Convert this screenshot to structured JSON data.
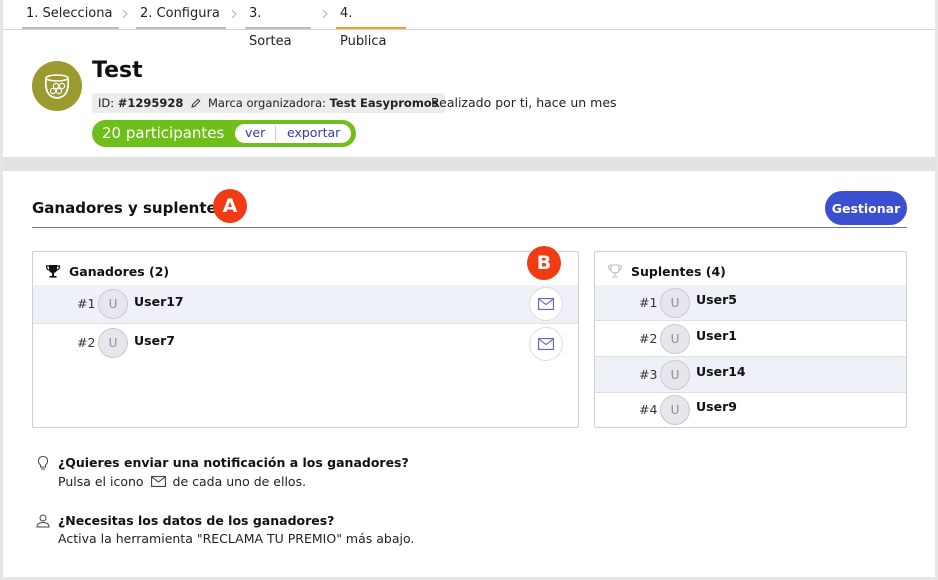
{
  "steps": [
    "1. Selecciona",
    "2. Configura",
    "3. Sortea",
    "4. Publica"
  ],
  "draw": {
    "title": "Test",
    "id_label": "ID:",
    "id_value": "#1295928",
    "brand_label": "Marca organizadora:",
    "brand_value": "Test Easypromos",
    "made_by": "Realizado por ti, hace un mes",
    "participants": "20 participantes",
    "view_link": "ver",
    "export_link": "exportar"
  },
  "section": {
    "title": "Ganadores y suplentes",
    "badge_a": "A",
    "badge_b": "B",
    "manage_button": "Gestionar"
  },
  "winners": {
    "header": "Ganadores (2)",
    "rows": [
      {
        "rank": "#1",
        "initial": "U",
        "name": "User17"
      },
      {
        "rank": "#2",
        "initial": "U",
        "name": "User7"
      }
    ]
  },
  "substitutes": {
    "header": "Suplentes (4)",
    "rows": [
      {
        "rank": "#1",
        "initial": "U",
        "name": "User5"
      },
      {
        "rank": "#2",
        "initial": "U",
        "name": "User1"
      },
      {
        "rank": "#3",
        "initial": "U",
        "name": "User14"
      },
      {
        "rank": "#4",
        "initial": "U",
        "name": "User9"
      }
    ]
  },
  "hints": {
    "notify_q": "¿Quieres enviar una notificación a los ganadores?",
    "notify_a_before": "Pulsa el icono",
    "notify_a_after": "de cada uno de ellos.",
    "data_q": "¿Necesitas los datos de los ganadores?",
    "data_a": "Activa la herramienta \"RECLAMA TU PREMIO\" más abajo."
  },
  "colors": {
    "accent_button": "#3b4fd1",
    "participants_pill": "#6fbf1a",
    "badge": "#f03c14",
    "active_step": "#f0a030",
    "avatar_bg": "#9a9a2e"
  },
  "icons": [
    "chevron-right-icon",
    "pencil-icon",
    "trophy-icon",
    "trophy-outline-icon",
    "mail-icon",
    "lightbulb-icon",
    "user-icon"
  ]
}
